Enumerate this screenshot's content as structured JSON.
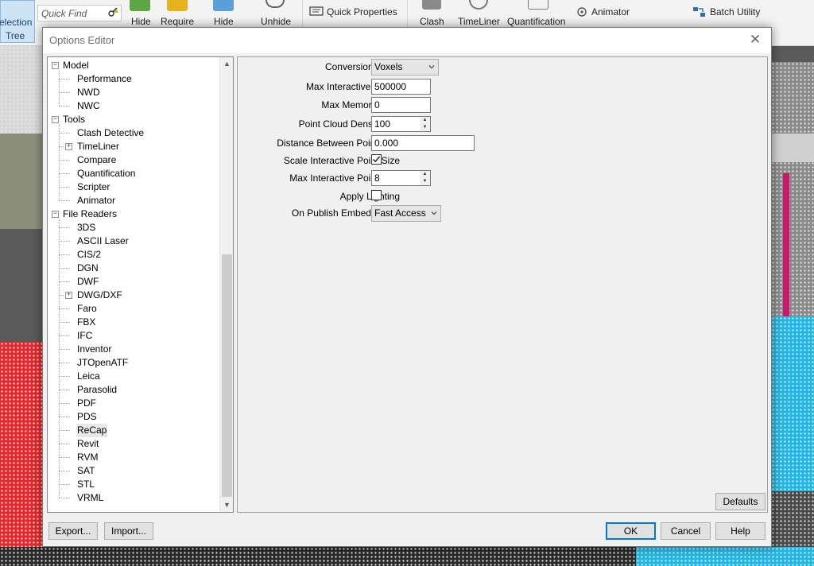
{
  "ribbon": {
    "selection_tree": {
      "line1": "election",
      "line2": "Tree"
    },
    "quick_find_placeholder": "Quick Find",
    "buttons": [
      {
        "label": "Hide"
      },
      {
        "label": "Require"
      },
      {
        "label": "Hide"
      },
      {
        "label": "Unhide"
      },
      {
        "label": "Clash"
      },
      {
        "label": "TimeLiner"
      },
      {
        "label": "Quantification"
      }
    ],
    "quick_properties": "Quick Properties",
    "animator": "Animator",
    "batch_utility": "Batch Utility"
  },
  "dialog": {
    "title": "Options Editor",
    "close_glyph": "✕"
  },
  "tree": {
    "items": [
      {
        "label": "Model",
        "level": 0,
        "expander": "−"
      },
      {
        "label": "Performance",
        "level": 1
      },
      {
        "label": "NWD",
        "level": 1
      },
      {
        "label": "NWC",
        "level": 1
      },
      {
        "label": "Tools",
        "level": 0,
        "expander": "−"
      },
      {
        "label": "Clash Detective",
        "level": 1
      },
      {
        "label": "TimeLiner",
        "level": 1,
        "expander": "+"
      },
      {
        "label": "Compare",
        "level": 1
      },
      {
        "label": "Quantification",
        "level": 1
      },
      {
        "label": "Scripter",
        "level": 1
      },
      {
        "label": "Animator",
        "level": 1
      },
      {
        "label": "File Readers",
        "level": 0,
        "expander": "−"
      },
      {
        "label": "3DS",
        "level": 1
      },
      {
        "label": "ASCII Laser",
        "level": 1
      },
      {
        "label": "CIS/2",
        "level": 1
      },
      {
        "label": "DGN",
        "level": 1
      },
      {
        "label": "DWF",
        "level": 1
      },
      {
        "label": "DWG/DXF",
        "level": 1,
        "expander": "+"
      },
      {
        "label": "Faro",
        "level": 1
      },
      {
        "label": "FBX",
        "level": 1
      },
      {
        "label": "IFC",
        "level": 1
      },
      {
        "label": "Inventor",
        "level": 1
      },
      {
        "label": "JTOpenATF",
        "level": 1
      },
      {
        "label": "Leica",
        "level": 1
      },
      {
        "label": "Parasolid",
        "level": 1
      },
      {
        "label": "PDF",
        "level": 1
      },
      {
        "label": "PDS",
        "level": 1
      },
      {
        "label": "ReCap",
        "level": 1,
        "selected": true
      },
      {
        "label": "Revit",
        "level": 1
      },
      {
        "label": "RVM",
        "level": 1
      },
      {
        "label": "SAT",
        "level": 1
      },
      {
        "label": "STL",
        "level": 1
      },
      {
        "label": "VRML",
        "level": 1
      }
    ]
  },
  "settings": {
    "conversion_mode": {
      "label": "Conversion Mode",
      "value": "Voxels"
    },
    "max_interactive_points": {
      "label": "Max Interactive Points",
      "value": "500000"
    },
    "max_memory": {
      "label": "Max Memory (MB)",
      "value": "0"
    },
    "point_cloud_density": {
      "label": "Point Cloud Density (%)",
      "value": "100"
    },
    "distance_between_points": {
      "label": "Distance Between Points (m)",
      "value": "0.000"
    },
    "scale_interactive_point_size": {
      "label": "Scale Interactive Point Size",
      "checked": true
    },
    "max_interactive_point_size": {
      "label": "Max Interactive Point Size",
      "value": "8"
    },
    "apply_lighting": {
      "label": "Apply Lighting",
      "checked": false
    },
    "on_publish_embed_xrefs": {
      "label": "On Publish Embed XRefs",
      "value": "Fast Access"
    }
  },
  "footer": {
    "defaults": "Defaults",
    "export": "Export...",
    "import": "Import...",
    "ok": "OK",
    "cancel": "Cancel",
    "help": "Help"
  },
  "colors": {
    "accent": "#0078d7",
    "scene_red": "#e8262b",
    "scene_cyan": "#1fb8e6",
    "scene_magenta": "#c8196e"
  }
}
